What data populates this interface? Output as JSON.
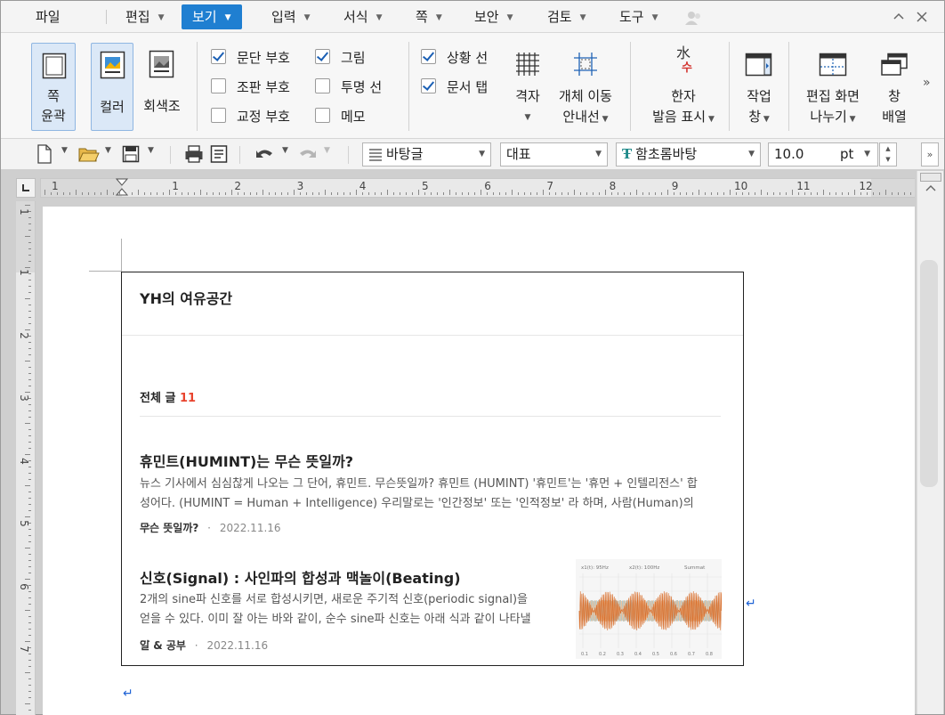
{
  "menubar": {
    "items": [
      "파일",
      "편집",
      "보기",
      "입력",
      "서식",
      "쪽",
      "보안",
      "검토",
      "도구"
    ],
    "active": "보기",
    "icons": [
      "pin-icon",
      "chevron-up-icon",
      "close-icon"
    ]
  },
  "ribbon": {
    "page_outline": {
      "line1": "쪽",
      "line2": "윤곽"
    },
    "color": "컬러",
    "grayscale": "회색조",
    "checks": [
      {
        "label": "문단 부호",
        "checked": true
      },
      {
        "label": "조판 부호",
        "checked": false
      },
      {
        "label": "교정 부호",
        "checked": false
      },
      {
        "label": "그림",
        "checked": true
      },
      {
        "label": "투명 선",
        "checked": false
      },
      {
        "label": "메모",
        "checked": false
      },
      {
        "label": "상황 선",
        "checked": true
      },
      {
        "label": "문서 탭",
        "checked": true
      }
    ],
    "grid": "격자",
    "object_move": {
      "line1": "개체 이동",
      "line2": "안내선"
    },
    "hanja": {
      "line1": "한자",
      "line2": "발음 표시",
      "icon_top": "水",
      "icon_bottom": "수"
    },
    "work_window": {
      "line1": "작업",
      "line2": "창"
    },
    "split_view": {
      "line1": "편집 화면",
      "line2": "나누기"
    },
    "window_arrange": {
      "line1": "창",
      "line2": "배열"
    },
    "more": "»"
  },
  "toolbar": {
    "style": "바탕글",
    "lang": "대표",
    "font": "함초롬바탕",
    "size": "10.0",
    "unit": "pt"
  },
  "ruler": {
    "h_numbers": [
      "1",
      "1",
      "2",
      "3",
      "4",
      "5",
      "6",
      "7",
      "8",
      "9",
      "10",
      "11",
      "12"
    ],
    "v_numbers": [
      "1",
      "1",
      "2",
      "3",
      "4",
      "5",
      "6",
      "7"
    ]
  },
  "blog": {
    "title": "YH의 여유공간",
    "total_label": "전체 글",
    "total_count": "11",
    "posts": [
      {
        "title": "휴민트(HUMINT)는 무슨 뜻일까?",
        "excerpt": "뉴스 기사에서 심심찮게 나오는 그 단어, 휴민트. 무슨뜻일까? 휴민트 (HUMINT) '휴민트'는 '휴먼 + 인텔리전스' 합성어다. (HUMINT = Human + Intelligence) 우리말로는 '인간정보' 또는 '인적정보' 라 하며, 사람(Human)의 ...",
        "category": "무슨 뜻일까?",
        "date": "2022.11.16"
      },
      {
        "title": "신호(Signal) : 사인파의 합성과 맥놀이(Beating)",
        "excerpt": "2개의 sine파 신호를 서로 합성시키면, 새로운 주기적 신호(periodic signal)을 얻을 수 있다. 이미 잘 아는 바와 같이, 순수 sine파 신호는 아래 식과 같이 나타낼 ...",
        "category": "일 & 공부",
        "date": "2022.11.16",
        "thumb_legend": [
          "x1(t): 95Hz",
          "x2(t): 100Hz",
          "Summat"
        ],
        "thumb_ticks": [
          "0.1",
          "0.2",
          "0.3",
          "0.4",
          "0.5",
          "0.6",
          "0.7",
          "0.8"
        ]
      }
    ],
    "separator": "·"
  }
}
